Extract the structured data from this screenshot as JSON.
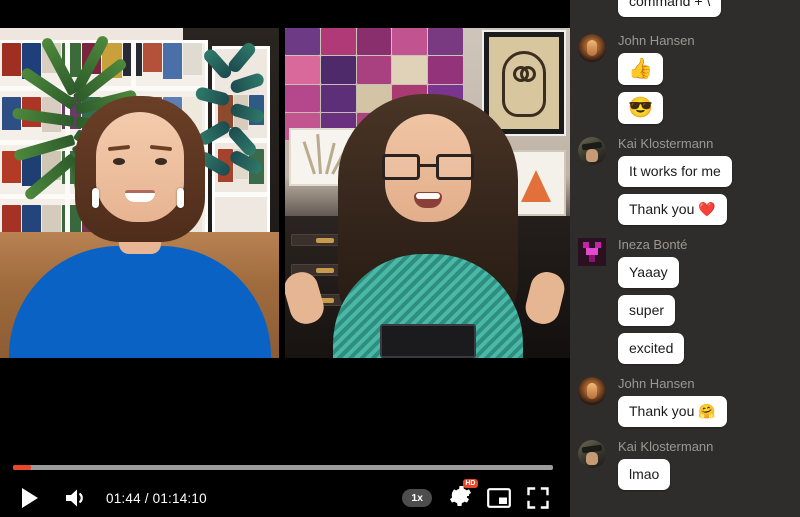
{
  "player": {
    "time_current": "01:44",
    "time_total": "01:14:10",
    "time_display": "01:44 / 01:14:10",
    "progress_percent": 3.3,
    "progress_color": "#e8472c",
    "play_label": "Play",
    "volume_label": "Volume",
    "speed_label": "1x",
    "settings_label": "Settings",
    "quality_badge": "HD",
    "miniplayer_label": "Miniplayer",
    "fullscreen_label": "Full screen"
  },
  "video": {
    "tiles": [
      {
        "name": "participant-left",
        "description": "Woman in blue sweater with earbuds, bookshelf background"
      },
      {
        "name": "participant-right",
        "description": "Woman with glasses and headphones, colorful art wall background"
      }
    ]
  },
  "chat": {
    "background": "#2f2d2c",
    "partial_top_message": "command + \\",
    "groups": [
      {
        "author": "John Hansen",
        "avatar": "john-avatar",
        "messages": [
          {
            "text": "👍",
            "type": "emoji"
          },
          {
            "text": "😎",
            "type": "emoji"
          }
        ]
      },
      {
        "author": "Kai Klostermann",
        "avatar": "kai-avatar",
        "messages": [
          {
            "text": "It works for me",
            "type": "text"
          },
          {
            "text": "Thank you ❤️",
            "type": "text"
          }
        ]
      },
      {
        "author": "Ineza Bonté",
        "avatar": "ineza-avatar",
        "messages": [
          {
            "text": "Yaaay",
            "type": "text"
          },
          {
            "text": "super",
            "type": "text"
          },
          {
            "text": "excited",
            "type": "text"
          }
        ]
      },
      {
        "author": "John Hansen",
        "avatar": "john-avatar",
        "messages": [
          {
            "text": "Thank you 🤗",
            "type": "text"
          }
        ]
      },
      {
        "author": "Kai Klostermann",
        "avatar": "kai-avatar",
        "messages": [
          {
            "text": "lmao",
            "type": "text"
          }
        ]
      }
    ]
  }
}
